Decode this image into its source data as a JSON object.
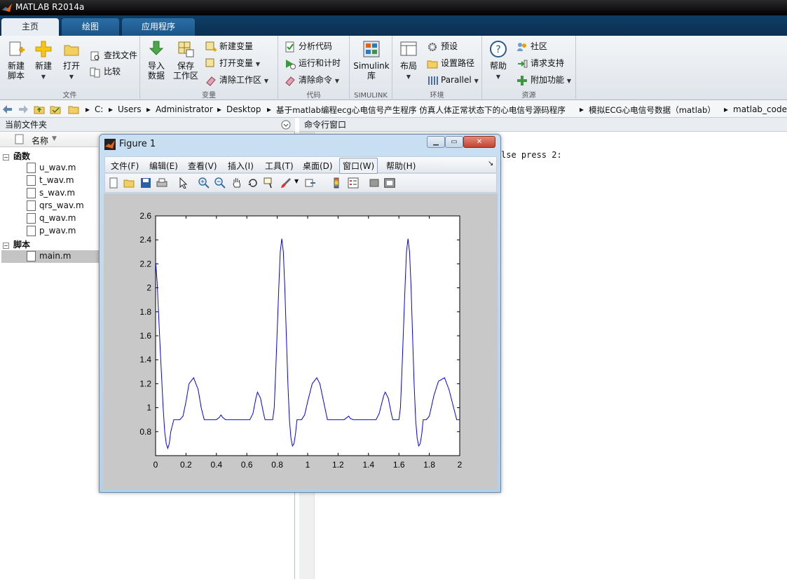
{
  "app": {
    "title": "MATLAB R2014a"
  },
  "tabs": [
    {
      "label": "主页"
    },
    {
      "label": "绘图"
    },
    {
      "label": "应用程序"
    }
  ],
  "ribbon": {
    "file_group": {
      "new_script": "新建\n脚本",
      "new": "新建",
      "open": "打开",
      "find_files": "查找文件",
      "compare": "比较",
      "label": "文件"
    },
    "var_group": {
      "import": "导入\n数据",
      "save_ws": "保存\n工作区",
      "new_var": "新建变量",
      "open_var": "打开变量",
      "clear_ws": "清除工作区",
      "label": "变量"
    },
    "code_group": {
      "analyze": "分析代码",
      "run_time": "运行和计时",
      "clear_cmd": "清除命令",
      "label": "代码"
    },
    "simulink_group": {
      "simulink": "Simulink\n库",
      "label": "SIMULINK"
    },
    "env_group": {
      "layout": "布局",
      "prefs": "预设",
      "set_path": "设置路径",
      "parallel": "Parallel",
      "label": "环境"
    },
    "res_group": {
      "help": "帮助",
      "community": "社区",
      "support": "请求支持",
      "addons": "附加功能",
      "label": "资源"
    }
  },
  "address": {
    "segments": [
      "C:",
      "Users",
      "Administrator",
      "Desktop",
      "基于matlab编程ecg心电信号产生程序 仿真人体正常状态下的心电信号源码程序",
      "模拟ECG心电信号数据（matlab）",
      "matlab_code"
    ]
  },
  "current_folder": {
    "title": "当前文件夹",
    "column": "名称",
    "groups": [
      {
        "label": "函数",
        "files": [
          "u_wav.m",
          "t_wav.m",
          "s_wav.m",
          "qrs_wav.m",
          "q_wav.m",
          "p_wav.m"
        ]
      },
      {
        "label": "脚本",
        "files": [
          "main.m"
        ]
      }
    ]
  },
  "command_window": {
    "title": "命令行窗口",
    "visible_text": "lse press 2:"
  },
  "figure": {
    "title": "Figure 1",
    "menu": [
      "文件(F)",
      "编辑(E)",
      "查看(V)",
      "插入(I)",
      "工具(T)",
      "桌面(D)",
      "窗口(W)",
      "帮助(H)"
    ]
  },
  "chart_data": {
    "type": "line",
    "title": "",
    "xlabel": "",
    "ylabel": "",
    "xlim": [
      0,
      2
    ],
    "ylim": [
      0.6,
      2.6
    ],
    "xticks": [
      "0",
      "0.2",
      "0.4",
      "0.6",
      "0.8",
      "1",
      "1.2",
      "1.4",
      "1.6",
      "1.8",
      "2"
    ],
    "yticks": [
      "0.8",
      "1",
      "1.2",
      "1.4",
      "1.6",
      "1.8",
      "2",
      "2.2",
      "2.4",
      "2.6"
    ],
    "grid": false,
    "color": "#0000ff",
    "series": [
      {
        "x": [
          0,
          0.01,
          0.03,
          0.05,
          0.06,
          0.07,
          0.08,
          0.09,
          0.1,
          0.12,
          0.14,
          0.16,
          0.18,
          0.2,
          0.22,
          0.25,
          0.28,
          0.3,
          0.32,
          0.34,
          0.36,
          0.38,
          0.4,
          0.42,
          0.43,
          0.44,
          0.46,
          0.5,
          0.55,
          0.6,
          0.62,
          0.64,
          0.66,
          0.67,
          0.69,
          0.71,
          0.72,
          0.75,
          0.77,
          0.78,
          0.79,
          0.8,
          0.81,
          0.82,
          0.83,
          0.84,
          0.85,
          0.86,
          0.87,
          0.88,
          0.89,
          0.9,
          0.91,
          0.92,
          0.93,
          0.94,
          0.96,
          0.98,
          1.0,
          1.03,
          1.06,
          1.08,
          1.1,
          1.13,
          1.16,
          1.18,
          1.2,
          1.24,
          1.26,
          1.27,
          1.28,
          1.3,
          1.35,
          1.4,
          1.45,
          1.47,
          1.5,
          1.51,
          1.53,
          1.55,
          1.56,
          1.6,
          1.61,
          1.62,
          1.63,
          1.64,
          1.65,
          1.66,
          1.67,
          1.68,
          1.69,
          1.7,
          1.71,
          1.72,
          1.73,
          1.74,
          1.75,
          1.76,
          1.78,
          1.8,
          1.83,
          1.86,
          1.9,
          1.93,
          1.96,
          1.98,
          2.0
        ],
        "y": [
          2.22,
          2.05,
          1.5,
          1.0,
          0.8,
          0.7,
          0.66,
          0.7,
          0.8,
          0.9,
          0.9,
          0.9,
          0.93,
          1.05,
          1.2,
          1.25,
          1.15,
          1.0,
          0.9,
          0.9,
          0.9,
          0.9,
          0.9,
          0.92,
          0.94,
          0.92,
          0.9,
          0.9,
          0.9,
          0.9,
          0.9,
          0.95,
          1.08,
          1.13,
          1.08,
          0.95,
          0.9,
          0.9,
          0.9,
          1.0,
          1.3,
          1.65,
          2.0,
          2.3,
          2.41,
          2.3,
          2.0,
          1.6,
          1.2,
          0.9,
          0.75,
          0.68,
          0.7,
          0.78,
          0.9,
          0.9,
          0.9,
          0.94,
          1.05,
          1.2,
          1.25,
          1.2,
          1.08,
          0.9,
          0.9,
          0.9,
          0.9,
          0.9,
          0.92,
          0.93,
          0.91,
          0.9,
          0.9,
          0.9,
          0.9,
          0.95,
          1.1,
          1.13,
          1.08,
          0.95,
          0.9,
          0.9,
          1.0,
          1.3,
          1.65,
          2.0,
          2.3,
          2.41,
          2.3,
          2.0,
          1.6,
          1.2,
          0.9,
          0.75,
          0.68,
          0.7,
          0.78,
          0.9,
          0.9,
          0.93,
          1.1,
          1.22,
          1.25,
          1.15,
          1.0,
          0.9,
          0.9
        ]
      }
    ]
  }
}
